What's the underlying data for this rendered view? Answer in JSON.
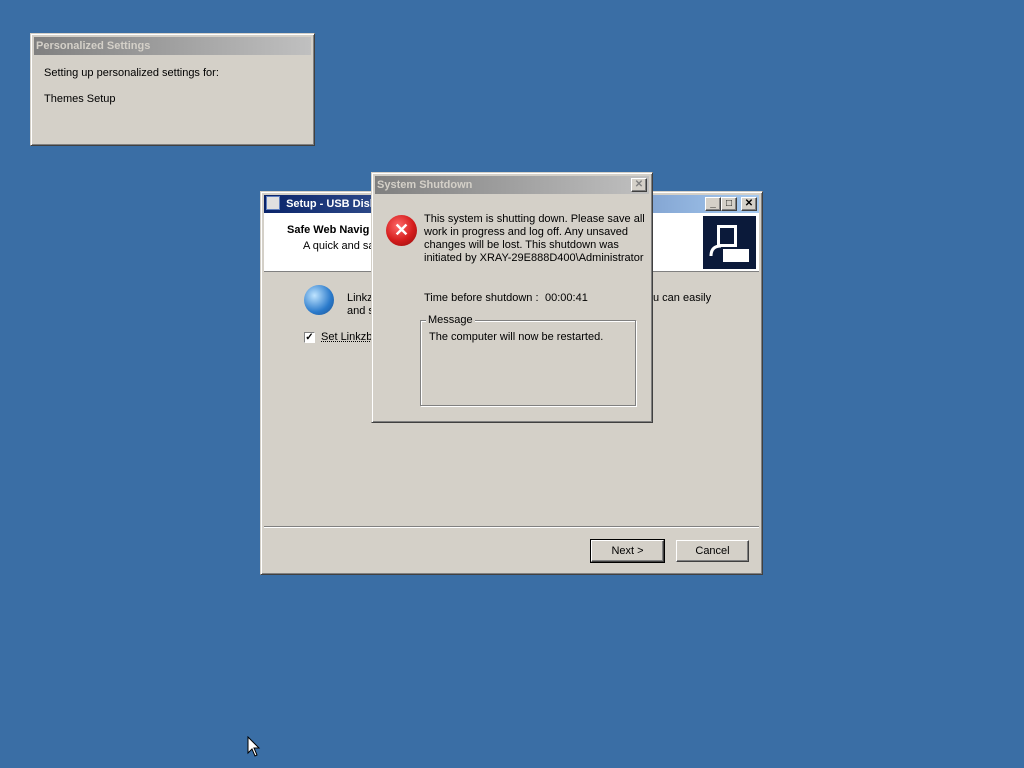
{
  "personalized": {
    "title": "Personalized Settings",
    "line1": "Setting up personalized settings for:",
    "line2": "Themes Setup"
  },
  "setup": {
    "title": "Setup - USB Disk",
    "header_title": "Safe Web Navig",
    "header_subtitle": "A quick and sa",
    "body_text_1": "Linkzb",
    "body_text_2": "and s",
    "body_text_right": "u can easily",
    "checkbox_label": "Set Linkzb",
    "checkbox_checked": "✓",
    "next_label": "Next >",
    "cancel_label": "Cancel",
    "minimize_glyph": "_",
    "maximize_glyph": "□",
    "close_glyph": "✕"
  },
  "shutdown": {
    "title": "System Shutdown",
    "close_glyph": "✕",
    "message_lines": [
      "This system is shutting down. Please save all",
      "work in progress and log off. Any unsaved",
      "changes will be lost. This shutdown was",
      "initiated by XRAY-29E888D400\\Administrator"
    ],
    "time_label": "Time before shutdown :",
    "time_value": "00:00:41",
    "group_label": "Message",
    "group_text": "The computer will now be restarted.",
    "error_icon_glyph": "✕"
  },
  "colors": {
    "desktop": "#3a6ea5",
    "window": "#d4d0c8",
    "error_red": "#d41c1c"
  }
}
